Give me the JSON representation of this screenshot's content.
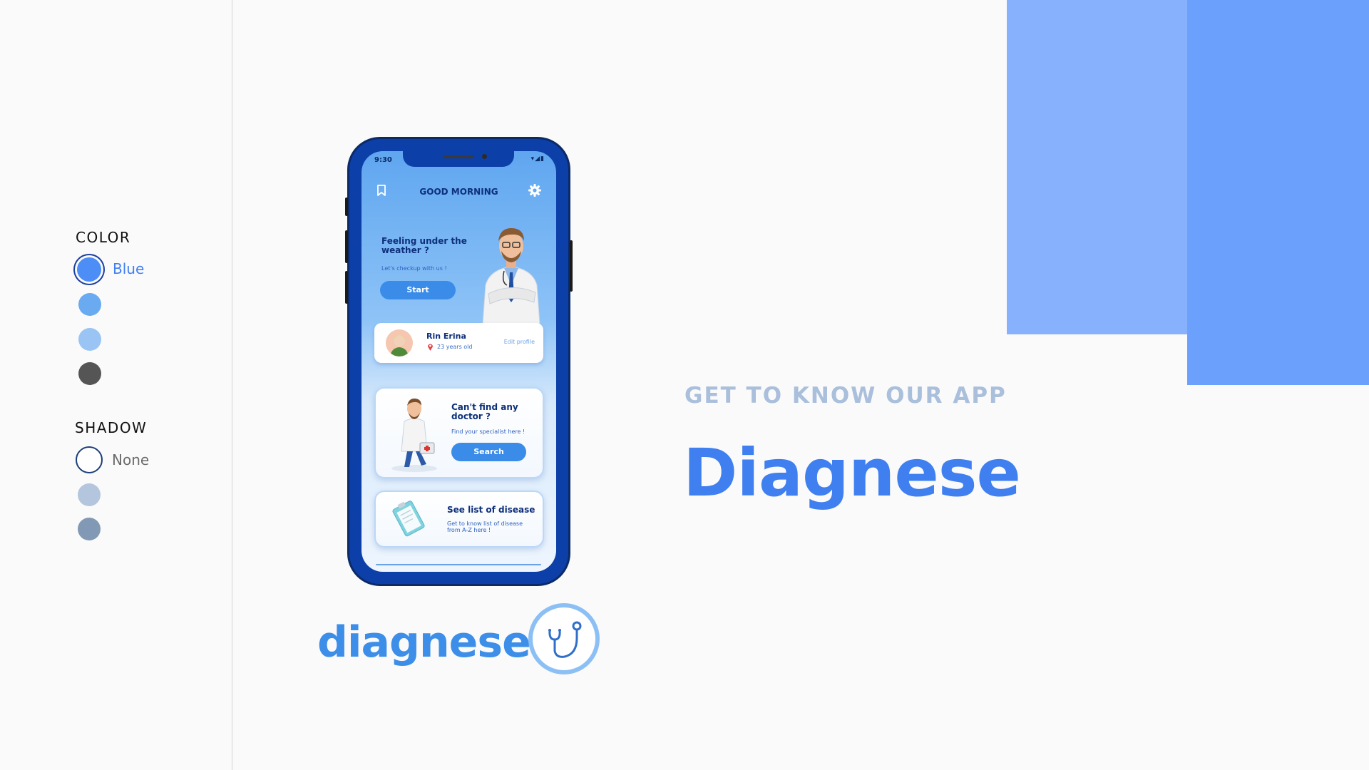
{
  "sidebar": {
    "color_title": "COLOR",
    "color_selected_label": "Blue",
    "color_swatches": [
      "#4c8df6",
      "#6aaaf0",
      "#99c4f4",
      "#555555"
    ],
    "shadow_title": "SHADOW",
    "shadow_selected_label": "None",
    "shadow_swatches": [
      "#ffffff",
      "#b3c6de",
      "#8299b5"
    ]
  },
  "hero": {
    "eyebrow": "GET TO KNOW OUR APP",
    "title": "Diagnese"
  },
  "logo": {
    "text": "diagnese",
    "icon": "stethoscope-icon"
  },
  "phone": {
    "status_time": "9:30",
    "status_icons": "▾◢▮",
    "greeting": "GOOD MORNING",
    "hero_heading": "Feeling under the weather ?",
    "hero_sub": "Let's checkup with us !",
    "start_label": "Start",
    "profile": {
      "name": "Rin Erina",
      "age": "23 years old",
      "edit_label": "Edit profile"
    },
    "find_card": {
      "heading": "Can't find any doctor ?",
      "sub": "Find your specialist here !",
      "button": "Search"
    },
    "disease_card": {
      "heading": "See list of disease",
      "sub": "Get to know list of disease from A-Z here !"
    }
  },
  "colors": {
    "accent": "#3f7ff0",
    "phone_frame": "#0d3fa8",
    "block_light": "#87b1fd",
    "block_dark": "#6ca0fd"
  }
}
